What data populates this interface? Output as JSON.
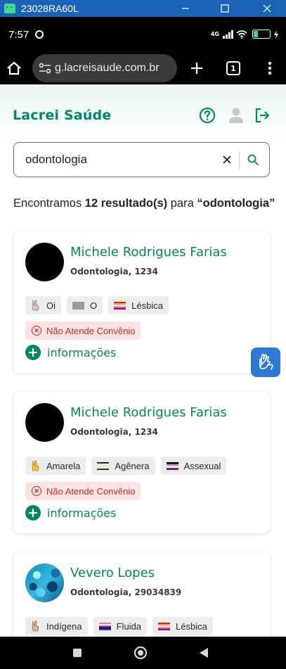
{
  "window": {
    "title": "23028RA60L"
  },
  "status_bar": {
    "time": "7:57",
    "network": "4G",
    "battery_level": "23",
    "battery_fraction": 0.23
  },
  "browser": {
    "url": "g.lacreisaude.com.br",
    "tab_count": "1"
  },
  "site": {
    "logo": "Lacrei Saúde",
    "brand_color": "#018762"
  },
  "search": {
    "value": "odontologia"
  },
  "results": {
    "prefix": "Encontramos ",
    "count": "12 resultado(s)",
    "middle": " para ",
    "query": "“odontologia”"
  },
  "cards": [
    {
      "name": "Michele Rodrigues Farias",
      "specialty": "Odontologia, 1234",
      "tags": [
        {
          "icon": "hand-peace-icon",
          "label": "Oi"
        },
        {
          "icon": "gray-flag-icon",
          "label": "O"
        },
        {
          "icon": "lesbian-flag-icon",
          "label": "Lésbica"
        }
      ],
      "insurance": "Não Atende Convênio",
      "info_label": "informações"
    },
    {
      "name": "Michele Rodrigues Farias",
      "specialty": "Odontologia, 1234",
      "tags": [
        {
          "icon": "hand-peace-icon",
          "label": "Amarela"
        },
        {
          "icon": "agender-flag-icon",
          "label": "Agênera"
        },
        {
          "icon": "asexual-flag-icon",
          "label": "Assexual"
        }
      ],
      "insurance": "Não Atende Convênio",
      "info_label": "informações"
    },
    {
      "name": "Vevero Lopes",
      "specialty": "Odontologia, 29034839",
      "tags": [
        {
          "icon": "hand-peace-icon",
          "label": "Indígena"
        },
        {
          "icon": "genderfluid-flag-icon",
          "label": "Fluida"
        },
        {
          "icon": "lesbian-flag-icon",
          "label": "Lésbica"
        }
      ]
    }
  ]
}
